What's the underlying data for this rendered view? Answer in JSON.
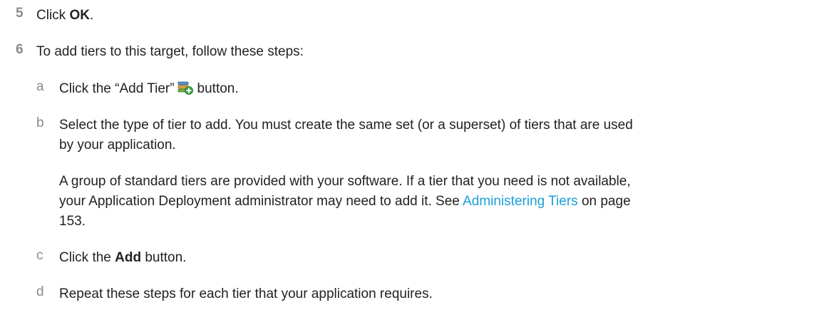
{
  "steps": {
    "s5": {
      "number": "5",
      "prefix": "Click ",
      "bold": "OK",
      "suffix": "."
    },
    "s6": {
      "number": "6",
      "text": "To add tiers to this target, follow these steps:"
    }
  },
  "substeps": {
    "a": {
      "letter": "a",
      "prefix": "Click the “Add Tier”",
      "suffix": "button.",
      "icon": "add-tier-icon"
    },
    "b": {
      "letter": "b",
      "line1": "Select the type of tier to add. You must create the same set (or a superset) of tiers that are used",
      "line2": "by your application.",
      "note_prefix": "A group of standard tiers are provided with your software. If a tier that you need is not available,",
      "note_mid": "your Application Deployment administrator may need to add it. See ",
      "link_text": "Administering Tiers",
      "note_on_page": " on page",
      "note_page": "153."
    },
    "c": {
      "letter": "c",
      "prefix": "Click the ",
      "bold": "Add",
      "suffix": " button."
    },
    "d": {
      "letter": "d",
      "text": "Repeat these steps for each tier that your application requires."
    }
  },
  "colors": {
    "link": "#1a9fd8",
    "step_number": "#8a8a8a",
    "text": "#222222"
  }
}
